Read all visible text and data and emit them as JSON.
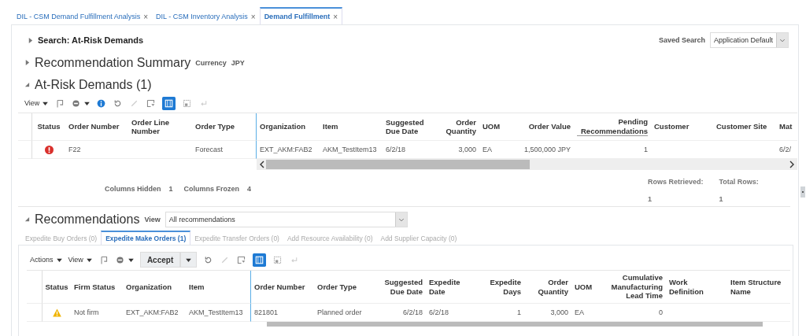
{
  "tabs": [
    {
      "label": "DIL - CSM Demand Fulfillment Analysis",
      "close": "×",
      "selected": false
    },
    {
      "label": "DIL - CSM Inventory Analysis",
      "close": "×",
      "selected": false
    },
    {
      "label": "Demand Fulfillment",
      "close": "×",
      "selected": true
    }
  ],
  "search": {
    "title": "Search: At-Risk Demands",
    "expanded": false,
    "saved_search_label": "Saved Search",
    "saved_search_value": "Application Default"
  },
  "summary": {
    "title": "Recommendation Summary",
    "expanded": false,
    "currency_label": "Currency",
    "currency": "JPY"
  },
  "at_risk": {
    "title": "At-Risk Demands (1)",
    "expanded": true,
    "view": "View",
    "columns": [
      "Status",
      "Order Number",
      "Order Line Number",
      "Order Type",
      "Organization",
      "Item",
      "Suggested Due Date",
      "Order Quantity",
      "UOM",
      "Order Value",
      "Pending Recommendations",
      "Customer",
      "Customer Site",
      "Mat"
    ],
    "rows": [
      {
        "kind": "error",
        "cells": [
          "",
          "F22",
          "",
          "Forecast",
          "EXT_AKM:FAB2",
          "AKM_TestItem13",
          "6/2/18",
          "3,000",
          "EA",
          "1,500,000 JPY",
          "1",
          "",
          "",
          "6/2/"
        ]
      }
    ],
    "columns_hidden_label": "Columns Hidden",
    "columns_hidden": "1",
    "columns_frozen_label": "Columns Frozen",
    "columns_frozen": "4",
    "rows_retrieved_label": "Rows Retrieved:",
    "rows_retrieved": "1",
    "total_rows_label": "Total Rows:",
    "total_rows": "1"
  },
  "recommendations": {
    "title": "Recommendations",
    "expanded": true,
    "view_label": "View",
    "view_value": "All recommendations",
    "tabs": [
      {
        "label": "Expedite Buy Orders (0)",
        "selected": false,
        "disabled": true
      },
      {
        "label": "Expedite Make Orders (1)",
        "selected": true,
        "disabled": false
      },
      {
        "label": "Expedite Transfer Orders (0)",
        "selected": false,
        "disabled": true
      },
      {
        "label": "Add Resource Availability (0)",
        "selected": false,
        "disabled": true
      },
      {
        "label": "Add Supplier Capacity (0)",
        "selected": false,
        "disabled": true
      }
    ],
    "actions": "Actions",
    "view": "View",
    "accept": "Accept",
    "columns": [
      "Status",
      "Firm Status",
      "Organization",
      "Item",
      "Order Number",
      "Order Type",
      "Suggested Due Date",
      "Expedite Date",
      "Expedite Days",
      "Order Quantity",
      "UOM",
      "Cumulative Manufacturing Lead Time",
      "Work Definition",
      "Item Structure Name"
    ],
    "rows": [
      {
        "kind": "warning",
        "cells": [
          "",
          "Not firm",
          "EXT_AKM:FAB2",
          "AKM_TestItem13",
          "821801",
          "Planned order",
          "6/2/18",
          "6/2/18",
          "1",
          "3,000",
          "EA",
          "0",
          "",
          ""
        ]
      }
    ]
  }
}
